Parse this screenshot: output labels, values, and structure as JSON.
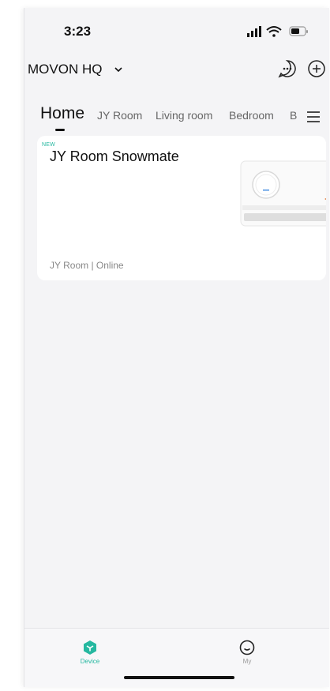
{
  "status_bar": {
    "time": "3:23",
    "icons": [
      "signal-icon",
      "wifi-icon",
      "battery-icon"
    ]
  },
  "header": {
    "home_name": "MOVON HQ",
    "icons": [
      "chat-icon",
      "add-icon"
    ]
  },
  "tabs": [
    {
      "label": "Home",
      "active": true
    },
    {
      "label": "JY Room",
      "active": false
    },
    {
      "label": "Living room",
      "active": false
    },
    {
      "label": "Bedroom",
      "active": false
    },
    {
      "label": "B",
      "active": false
    }
  ],
  "device_card": {
    "badge": "NEW",
    "title": "JY Room Snowmate",
    "status": "JY Room | Online"
  },
  "bottom_nav": {
    "items": [
      {
        "label": "Device",
        "active": true
      },
      {
        "label": "My",
        "active": false
      }
    ]
  },
  "colors": {
    "accent": "#25b8a0",
    "background": "#f4f4f6",
    "card": "#ffffff"
  }
}
